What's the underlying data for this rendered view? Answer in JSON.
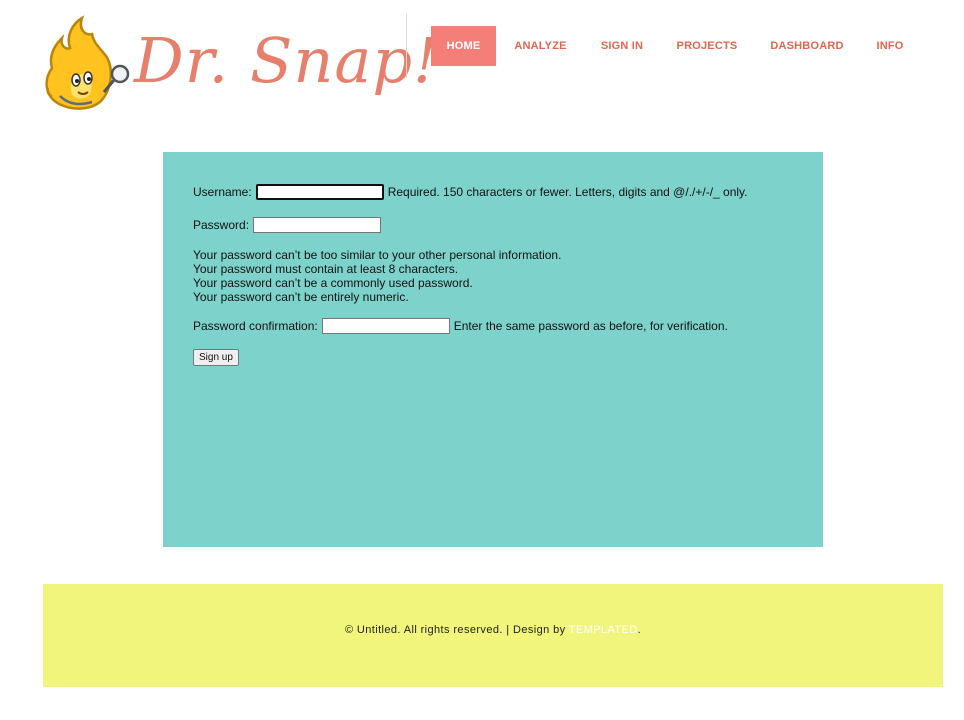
{
  "header": {
    "logo_text": "Dr. Snap!",
    "nav": [
      {
        "label": "HOME",
        "active": true
      },
      {
        "label": "ANALYZE",
        "active": false
      },
      {
        "label": "SIGN IN",
        "active": false
      },
      {
        "label": "PROJECTS",
        "active": false
      },
      {
        "label": "DASHBOARD",
        "active": false
      },
      {
        "label": "INFO",
        "active": false
      }
    ]
  },
  "form": {
    "username_label": "Username:",
    "username_value": "",
    "username_help": "Required. 150 characters or fewer. Letters, digits and @/./+/-/_ only.",
    "password_label": "Password:",
    "password_value": "",
    "password_hints": [
      "Your password can’t be too similar to your other personal information.",
      "Your password must contain at least 8 characters.",
      "Your password can’t be a commonly used password.",
      "Your password can’t be entirely numeric."
    ],
    "confirm_label": "Password confirmation:",
    "confirm_value": "",
    "confirm_help": "Enter the same password as before, for verification.",
    "submit_label": "Sign up"
  },
  "footer": {
    "text": "© Untitled. All rights reserved. | Design by ",
    "link_text": "TEMPLATED",
    "end": "."
  },
  "colors": {
    "accent": "#f47f79",
    "nav_text": "#e5654f",
    "panel_bg": "#7dd3cb",
    "footer_bg": "#f1f57b",
    "logo_text": "#e6806c"
  },
  "icons": {
    "logo_mascot": "flame-mascot-with-magnifier"
  }
}
